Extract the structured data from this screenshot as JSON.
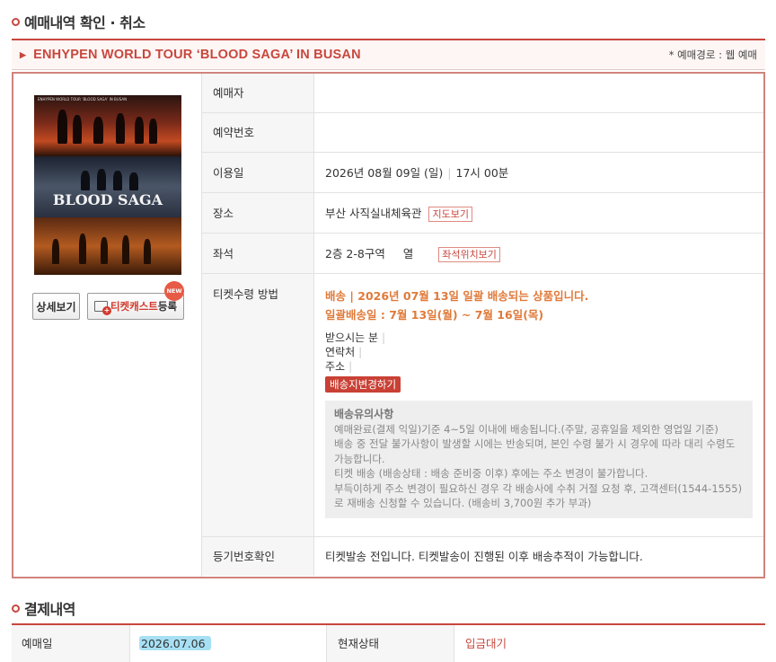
{
  "header": {
    "title": "예매내역 확인 · 취소"
  },
  "concert": {
    "title": "ENHYPEN WORLD TOUR ‘BLOOD SAGA’ IN BUSAN",
    "route": "* 예매경로 : 웹 예매"
  },
  "poster": {
    "title": "BLOOD SAGA",
    "top_text": "ENHYPEN WORLD TOUR ‘BLOOD SAGA’ IN BUSAN"
  },
  "buttons": {
    "detail": "상세보기",
    "ticketcast_red": "티켓캐스트",
    "ticketcast_rest": "등록",
    "new_badge": "NEW"
  },
  "details": {
    "booker_label": "예매자",
    "booker_value": "",
    "reservation_label": "예약번호",
    "reservation_value": "",
    "date_label": "이용일",
    "date_value": "2026년 08월 09일 (일)",
    "time_value": "17시 00분",
    "venue_label": "장소",
    "venue_value": "부산 사직실내체육관",
    "map_btn": "지도보기",
    "seat_label": "좌석",
    "seat_value": "2층 2-8구역     열",
    "seat_btn": "좌석위치보기",
    "ticket_method_label": "티켓수령 방법",
    "shipping_line1": "배송 | 2026년 07월 13일 일괄 배송되는 상품입니다.",
    "shipping_line2": "일괄배송일 : 7월 13일(월) ~ 7월 16일(목)",
    "receiver_label": "받으시는 분",
    "contact_label": "연락처",
    "address_label": "주소",
    "change_btn": "배송지변경하기",
    "notice_title": "배송유의사항",
    "notice_lines": [
      "예매완료(결제 익일)기준 4~5일 이내에 배송됩니다.(주말, 공휴일을 제외한 영업일 기준)",
      "배송 중 전달 불가사항이 발생할 시에는 반송되며, 본인 수령 불가 시 경우에 따라 대리 수령도 가능합니다.",
      "티켓 배송 (배송상태 : 배송 준비중 이후) 후에는 주소 변경이 불가합니다.",
      "부득이하게 주소 변경이 필요하신 경우 각 배송사에 수취 거절 요청 후, 고객센터(1544-1555)로 재배송 신청할 수 있습니다. (배송비 3,700원 추가 부과)"
    ],
    "tracking_label": "등기번호확인",
    "tracking_value": "티켓발송 전입니다. 티켓발송이 진행된 이후 배송추적이 가능합니다."
  },
  "payment": {
    "title": "결제내역",
    "date_label": "예매일",
    "date_value": "2026.07.06",
    "status_label": "현재상태",
    "status_value": "입금대기"
  },
  "colors": {
    "accent": "#c8473d",
    "shipping": "#e07a3a",
    "highlight": "#a7e0f4"
  }
}
